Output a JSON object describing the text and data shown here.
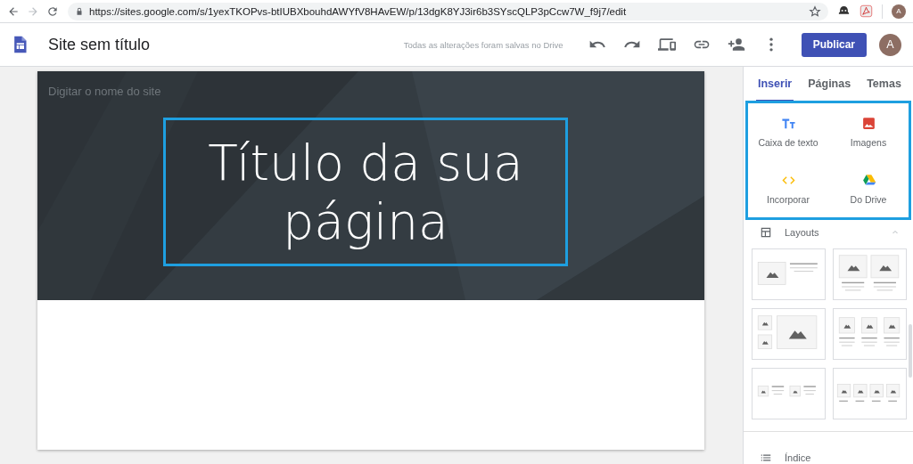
{
  "browser": {
    "url": "https://sites.google.com/s/1yexTKOPvs-btIUBXbouhdAWYfV8HAvEW/p/13dgK8YJ3ir6b3SYscQLP3pCcw7W_f9j7/edit",
    "avatar": "A"
  },
  "header": {
    "title": "Site sem título",
    "save_status": "Todas as alterações foram salvas no Drive",
    "publish_button": "Publicar",
    "avatar": "A"
  },
  "page": {
    "site_name": {
      "placeholder": "Digitar o nome do site"
    },
    "title": "Título da sua página"
  },
  "sidebar": {
    "tabs": [
      {
        "label": "Inserir",
        "selected": true
      },
      {
        "label": "Páginas",
        "selected": false
      },
      {
        "label": "Temas",
        "selected": false
      }
    ],
    "insert_items": [
      {
        "kind": "text",
        "label": "Caixa de texto"
      },
      {
        "kind": "images",
        "label": "Imagens"
      },
      {
        "kind": "embed",
        "label": "Incorporar"
      },
      {
        "kind": "drive",
        "label": "Do Drive"
      }
    ],
    "sections": [
      {
        "kind": "layouts",
        "label": "Layouts",
        "expanded": true
      },
      {
        "kind": "toc",
        "label": "Índice"
      }
    ]
  }
}
